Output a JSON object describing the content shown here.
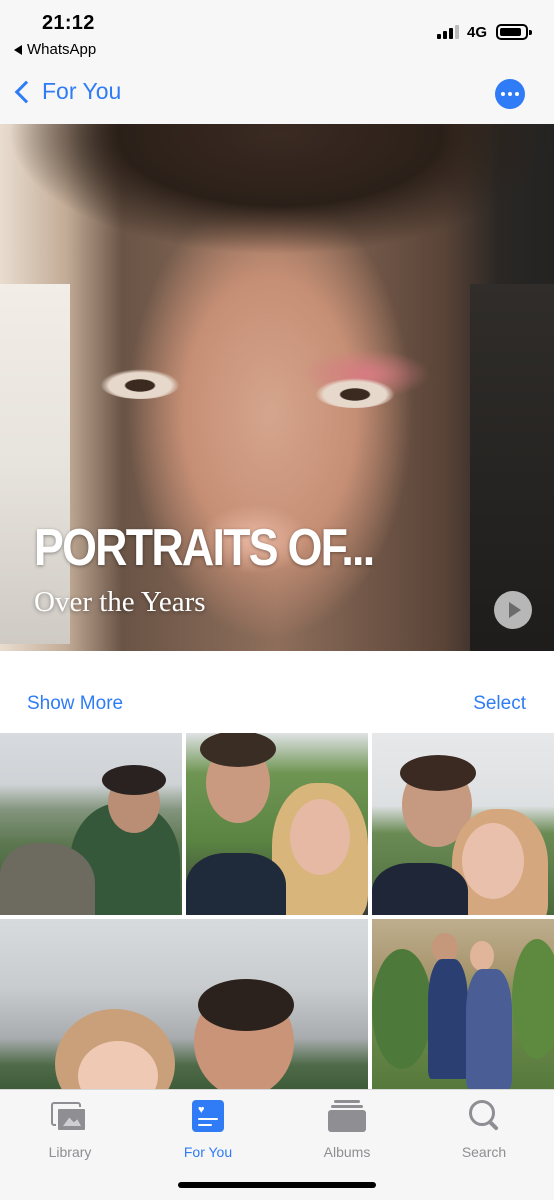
{
  "status_bar": {
    "time": "21:12",
    "back_app": "WhatsApp",
    "network": "4G"
  },
  "nav": {
    "back_label": "For You"
  },
  "memory": {
    "title": "PORTRAITS OF...",
    "subtitle": "Over the Years"
  },
  "actions": {
    "show_more": "Show More",
    "select": "Select"
  },
  "tabs": [
    {
      "label": "Library",
      "icon": "library-icon",
      "active": false
    },
    {
      "label": "For You",
      "icon": "for-you-icon",
      "active": true
    },
    {
      "label": "Albums",
      "icon": "albums-icon",
      "active": false
    },
    {
      "label": "Search",
      "icon": "search-icon",
      "active": false
    }
  ],
  "colors": {
    "accent": "#2f7cf6",
    "tab_inactive": "#8e8e93"
  }
}
